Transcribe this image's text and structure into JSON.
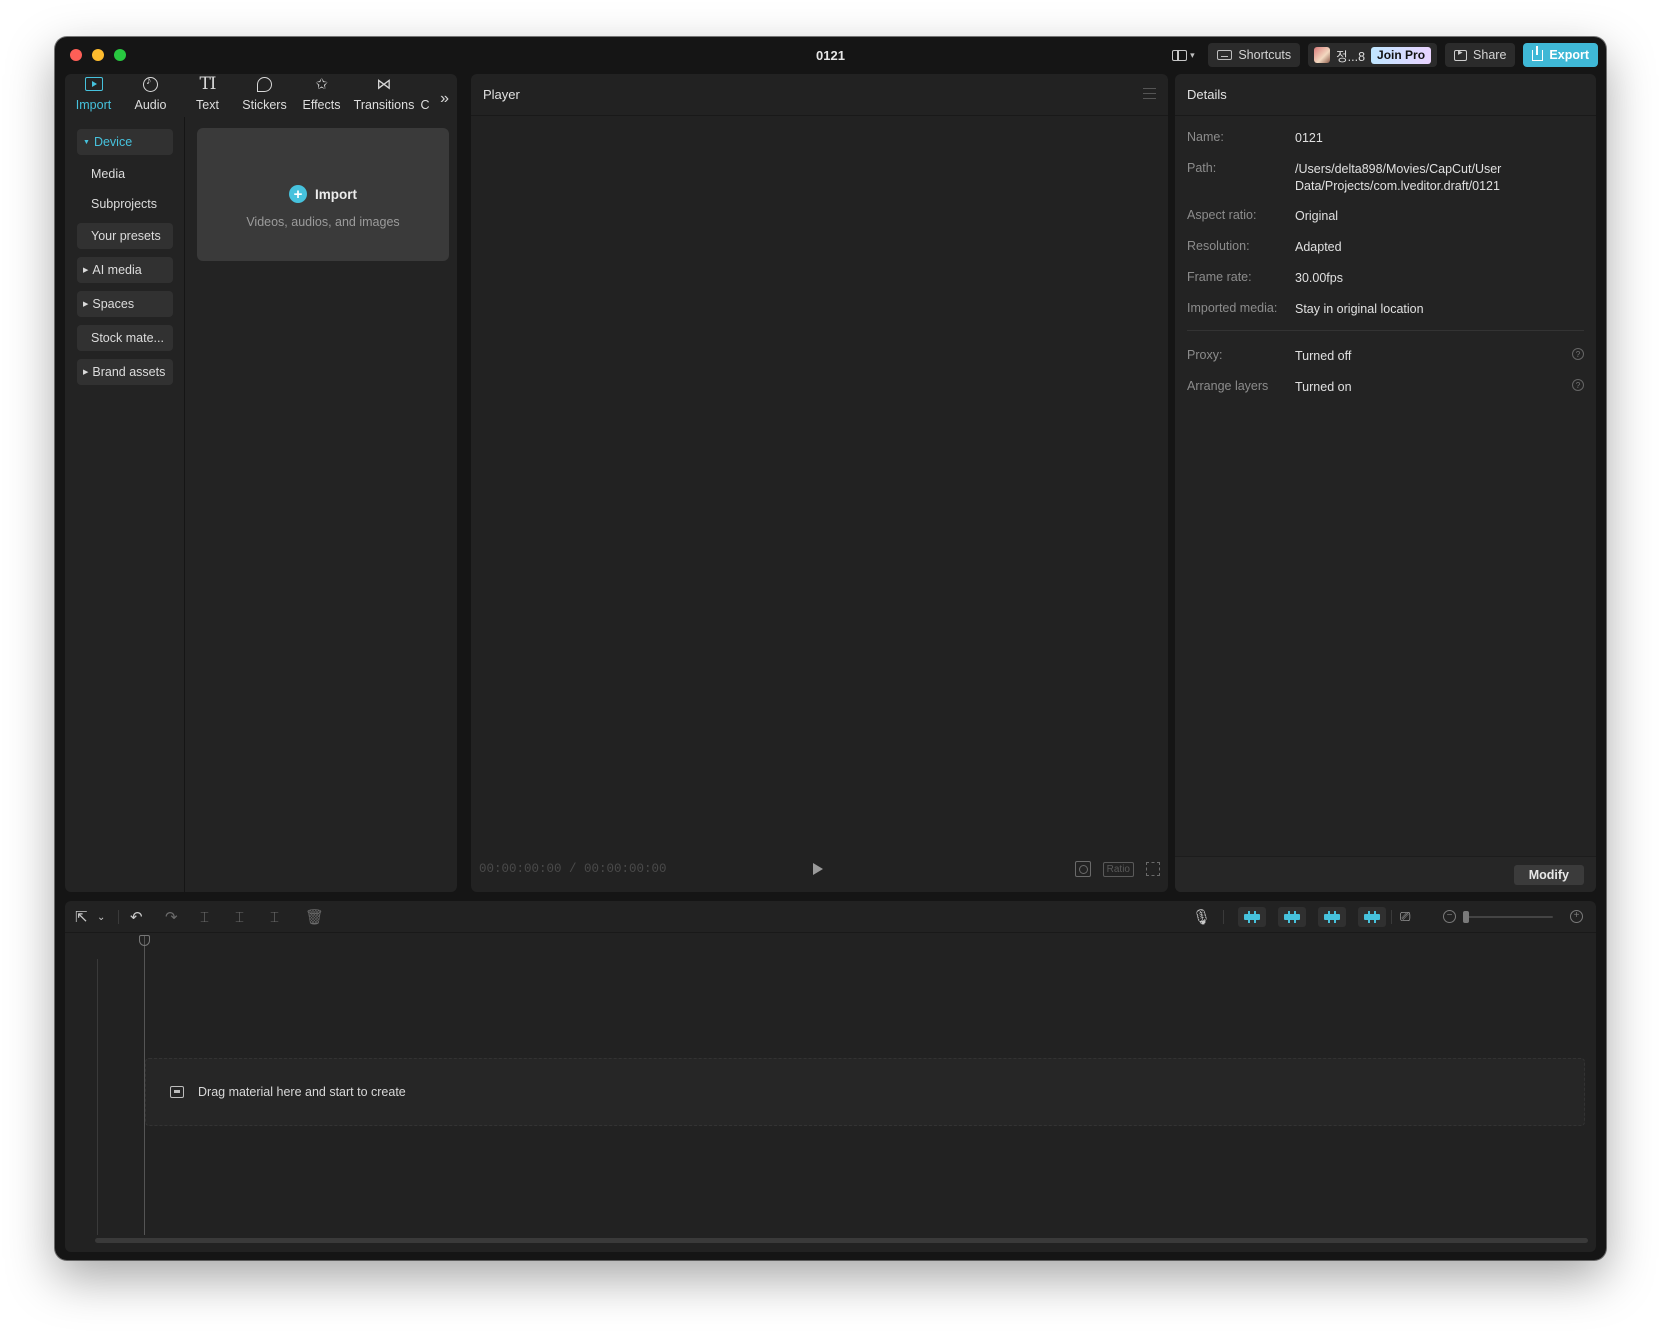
{
  "window": {
    "title": "0121",
    "colors": {
      "accent": "#46c2dd",
      "export": "#3fb8d6",
      "background": "#151515",
      "panel": "#232323"
    }
  },
  "topbar": {
    "layout_icon": "layout-icon",
    "shortcuts_label": "Shortcuts",
    "user_name": "정...8",
    "join_pro_label": "Join Pro",
    "share_label": "Share",
    "export_label": "Export"
  },
  "media_tabs": [
    {
      "label": "Import",
      "icon": "import-icon"
    },
    {
      "label": "Audio",
      "icon": "audio-icon"
    },
    {
      "label": "Text",
      "icon": "text-icon"
    },
    {
      "label": "Stickers",
      "icon": "sticker-icon"
    },
    {
      "label": "Effects",
      "icon": "effects-icon"
    },
    {
      "label": "Transitions",
      "icon": "transitions-icon"
    },
    {
      "label": "C",
      "icon": ""
    }
  ],
  "media_nav": {
    "device": "Device",
    "media": "Media",
    "subprojects": "Subprojects",
    "your_presets": "Your presets",
    "ai_media": "AI media",
    "spaces": "Spaces",
    "stock": "Stock mate...",
    "brand_assets": "Brand assets"
  },
  "import_card": {
    "title": "Import",
    "subtitle": "Videos, audios, and images"
  },
  "player": {
    "title": "Player",
    "timecode": "00:00:00:00 / 00:00:00:00",
    "ratio_label": "Ratio"
  },
  "details": {
    "title": "Details",
    "rows": {
      "name": {
        "label": "Name:",
        "value": "0121"
      },
      "path": {
        "label": "Path:",
        "value": "/Users/delta898/Movies/CapCut/User Data/Projects/com.lveditor.draft/0121"
      },
      "aspect": {
        "label": "Aspect ratio:",
        "value": "Original"
      },
      "resolution": {
        "label": "Resolution:",
        "value": "Adapted"
      },
      "framerate": {
        "label": "Frame rate:",
        "value": "30.00fps"
      },
      "imported": {
        "label": "Imported media:",
        "value": "Stay in original location"
      },
      "proxy": {
        "label": "Proxy:",
        "value": "Turned off"
      },
      "arrange": {
        "label": "Arrange layers",
        "value": "Turned on"
      }
    },
    "modify_label": "Modify"
  },
  "timeline": {
    "drop_hint": "Drag material here and start to create"
  }
}
